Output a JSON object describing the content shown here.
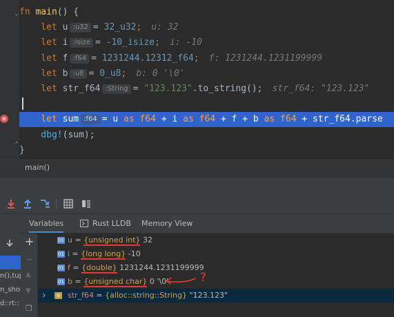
{
  "editor": {
    "lines": [
      {
        "tokens": [
          {
            "t": "fn ",
            "c": "kw"
          },
          {
            "t": "main",
            "c": "fn"
          },
          {
            "t": "() {",
            "c": "var"
          }
        ]
      },
      {
        "tokens": [
          {
            "t": "    let ",
            "c": "kw"
          },
          {
            "t": "u",
            "c": "var"
          },
          {
            "hint": "u32"
          },
          {
            "t": "= ",
            "c": "var"
          },
          {
            "t": "32_u32",
            "c": "num"
          },
          {
            "t": ";",
            "c": "kw"
          },
          {
            "inlay": "u: 32"
          }
        ]
      },
      {
        "tokens": [
          {
            "t": "    let ",
            "c": "kw"
          },
          {
            "t": "i",
            "c": "var"
          },
          {
            "hint": "isize"
          },
          {
            "t": "= ",
            "c": "var"
          },
          {
            "t": "-10_isize",
            "c": "num"
          },
          {
            "t": ";",
            "c": "kw"
          },
          {
            "inlay": "i: -10"
          }
        ]
      },
      {
        "tokens": [
          {
            "t": "    let ",
            "c": "kw"
          },
          {
            "t": "f",
            "c": "var"
          },
          {
            "hint": "f64"
          },
          {
            "t": "= ",
            "c": "var"
          },
          {
            "t": "1231244.12312_f64",
            "c": "num"
          },
          {
            "t": ";",
            "c": "kw"
          },
          {
            "inlay": "f: 1231244.1231199999"
          }
        ]
      },
      {
        "tokens": [
          {
            "t": "    let ",
            "c": "kw"
          },
          {
            "t": "b",
            "c": "var"
          },
          {
            "hint": "u8"
          },
          {
            "t": "= ",
            "c": "var"
          },
          {
            "t": "0_u8",
            "c": "num"
          },
          {
            "t": ";",
            "c": "kw"
          },
          {
            "inlay": "b: 0 '\\0'"
          }
        ]
      },
      {
        "tokens": [
          {
            "t": "    let ",
            "c": "kw"
          },
          {
            "t": "str_f64",
            "c": "var"
          },
          {
            "hint": "String"
          },
          {
            "t": "= ",
            "c": "var"
          },
          {
            "t": "\"123.123\"",
            "c": "str"
          },
          {
            "t": ".to_string();",
            "c": "var"
          },
          {
            "inlay": "str_f64: \"123.123\""
          }
        ]
      },
      {
        "tokens": []
      },
      {
        "tokens": [
          {
            "t": "    let ",
            "c": "kw"
          },
          {
            "t": "sum",
            "c": "var"
          },
          {
            "hint": "f64"
          },
          {
            "t": "= u ",
            "c": "var"
          },
          {
            "t": "as f64",
            "c": "kw"
          },
          {
            "t": " + i ",
            "c": "var"
          },
          {
            "t": "as f64",
            "c": "kw"
          },
          {
            "t": " + f + b ",
            "c": "var"
          },
          {
            "t": "as f64",
            "c": "kw"
          },
          {
            "t": " + str_f64.parse",
            "c": "var"
          }
        ]
      },
      {
        "tokens": [
          {
            "t": "    dbg!",
            "c": "mac"
          },
          {
            "t": "(sum);",
            "c": "var"
          }
        ]
      },
      {
        "tokens": [
          {
            "t": "}",
            "c": "var"
          }
        ]
      }
    ],
    "highlighted_line": 7
  },
  "breadcrumb": "main()",
  "debugger": {
    "tabs": [
      "Variables",
      "Rust LLDB",
      "Memory View"
    ],
    "active_tab": 0,
    "variables": [
      {
        "badge": "01",
        "name": "u",
        "type": "{unsigned int}",
        "value": "32"
      },
      {
        "badge": "01",
        "name": "i",
        "type": "{long long}",
        "value": "-10"
      },
      {
        "badge": "01",
        "name": "f",
        "type": "{double}",
        "value": "1231244.1231199999"
      },
      {
        "badge": "01",
        "name": "b",
        "type": "{unsigned char}",
        "value": "0 '\\0'"
      },
      {
        "badge": "≡",
        "name": "str_f64",
        "type": "{alloc::string::String}",
        "value": "\"123.123\""
      }
    ],
    "annotation": "?"
  },
  "frames": [
    "",
    "n(),tup",
    "n_shor",
    "d::rt::"
  ],
  "colors": {
    "accent": "#2f65ca",
    "underline": "#e53935"
  }
}
